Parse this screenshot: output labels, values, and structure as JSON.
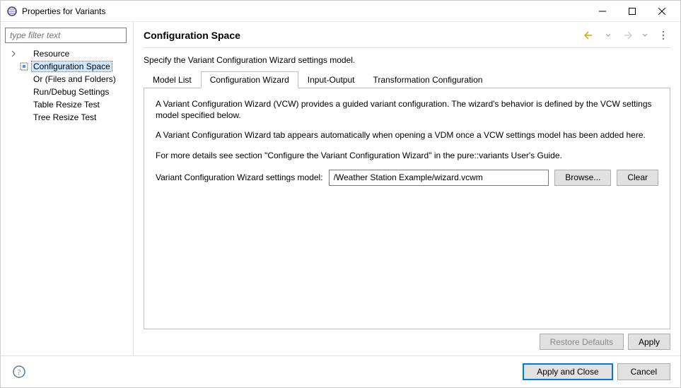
{
  "window": {
    "title": "Properties for Variants"
  },
  "filter_placeholder": "type filter text",
  "tree": {
    "items": [
      {
        "label": "Resource"
      },
      {
        "label": "Configuration Space"
      },
      {
        "label": "Or (Files and Folders)"
      },
      {
        "label": "Run/Debug Settings"
      },
      {
        "label": "Table Resize Test"
      },
      {
        "label": "Tree Resize Test"
      }
    ]
  },
  "heading": "Configuration Space",
  "description": "Specify the Variant Configuration Wizard settings model.",
  "tabs": {
    "items": [
      {
        "label": "Model List"
      },
      {
        "label": "Configuration Wizard"
      },
      {
        "label": "Input-Output"
      },
      {
        "label": "Transformation Configuration"
      }
    ]
  },
  "panel": {
    "p1": "A Variant Configuration Wizard (VCW) provides a guided variant configuration. The wizard's behavior is defined by the VCW settings model specified below.",
    "p2": "A Variant Configuration Wizard tab appears automatically when opening a VDM once a VCW settings model has been added here.",
    "p3": "For more details see section \"Configure the Variant Configuration Wizard\" in the pure::variants User's Guide.",
    "field_label": "Variant Configuration Wizard settings model:",
    "field_value": "/Weather Station Example/wizard.vcwm",
    "browse": "Browse...",
    "clear": "Clear"
  },
  "buttons": {
    "restore": "Restore Defaults",
    "apply": "Apply",
    "apply_close": "Apply and Close",
    "cancel": "Cancel"
  }
}
